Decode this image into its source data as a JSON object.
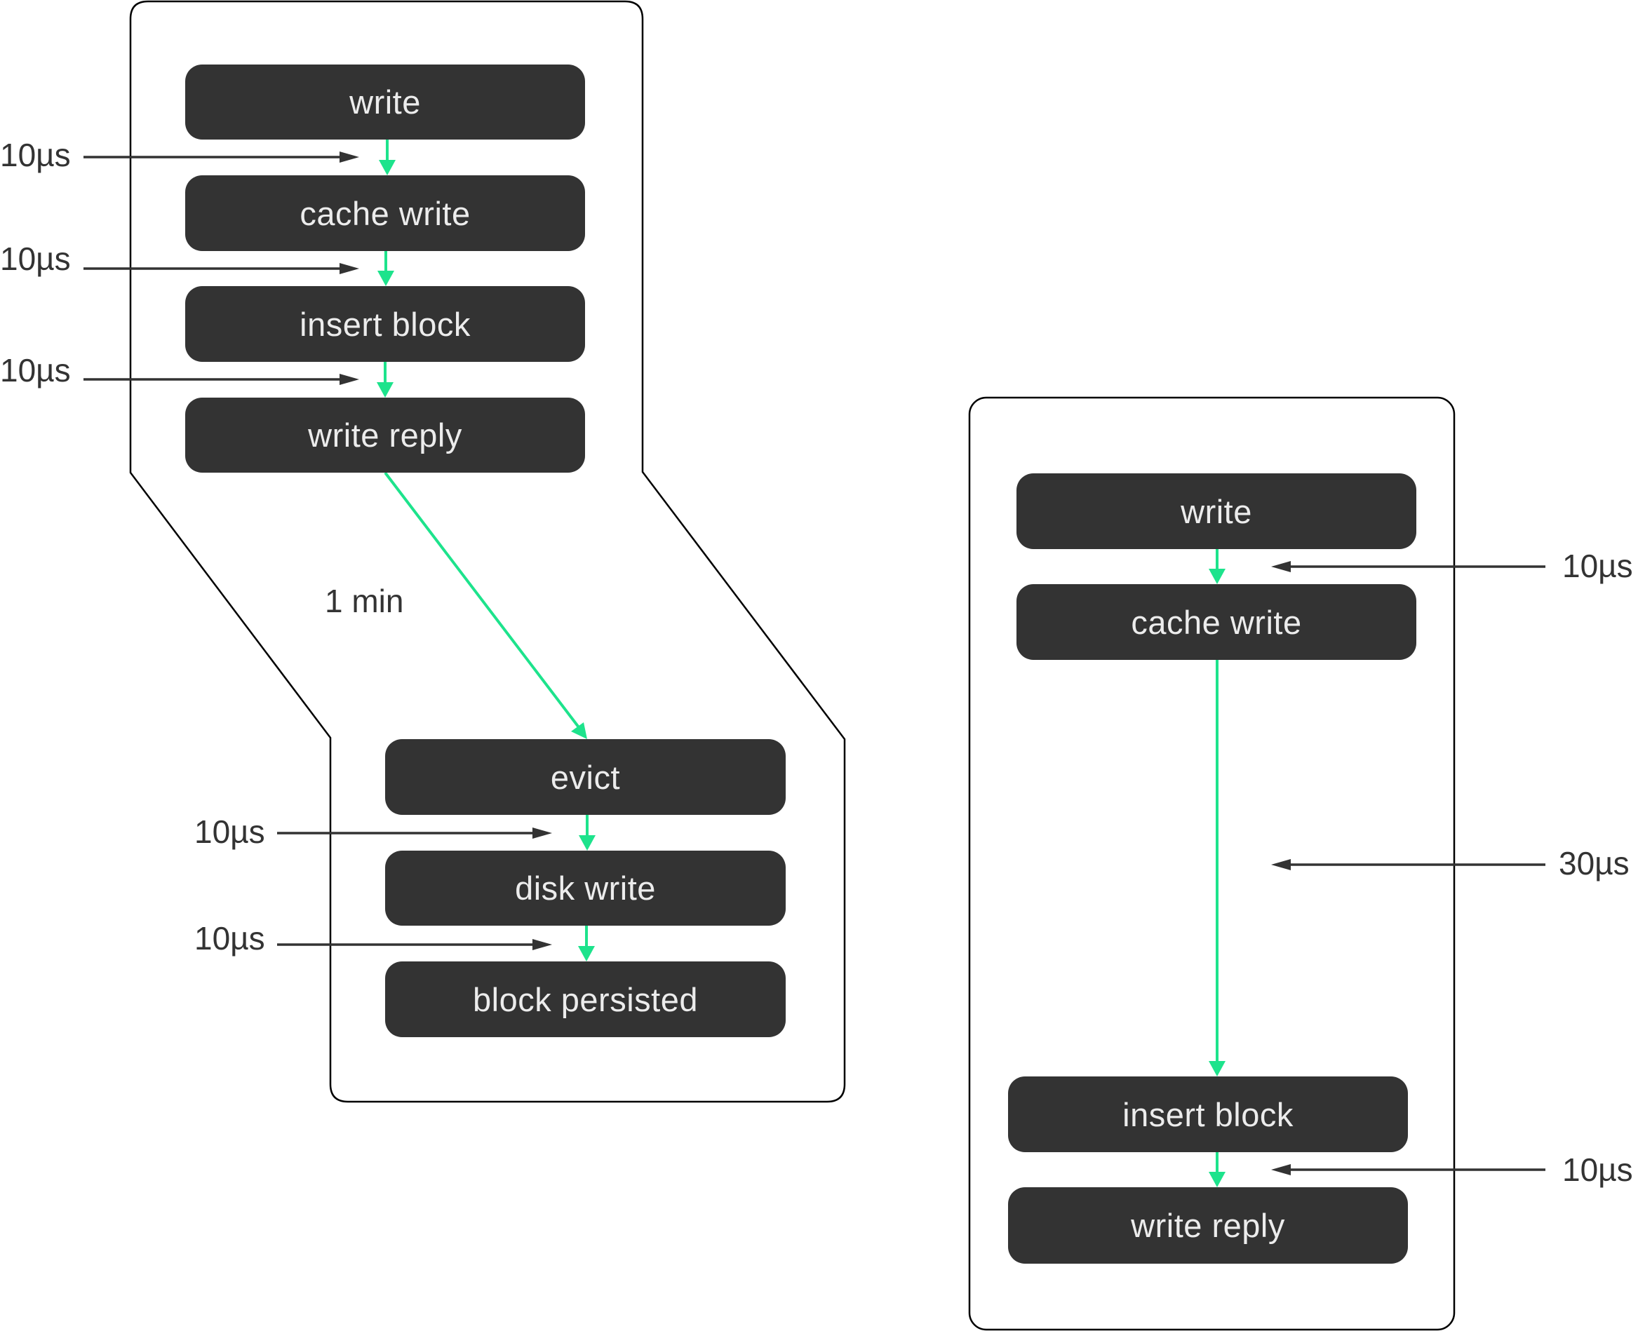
{
  "colors": {
    "step_fill": "#333333",
    "step_text": "#ececec",
    "flow_arrow": "#1de38c",
    "timing_arrow": "#333333",
    "panel_border": "#000000"
  },
  "left_diagram": {
    "upper_steps": [
      "write",
      "cache write",
      "insert block",
      "write reply"
    ],
    "upper_timings": [
      "10µs",
      "10µs",
      "10µs"
    ],
    "transition_label": "1 min",
    "lower_steps": [
      "evict",
      "disk write",
      "block persisted"
    ],
    "lower_timings": [
      "10µs",
      "10µs"
    ]
  },
  "right_diagram": {
    "steps": [
      "write",
      "cache write",
      "insert block",
      "write reply"
    ],
    "timings": [
      "10µs",
      "30µs",
      "10µs"
    ]
  }
}
